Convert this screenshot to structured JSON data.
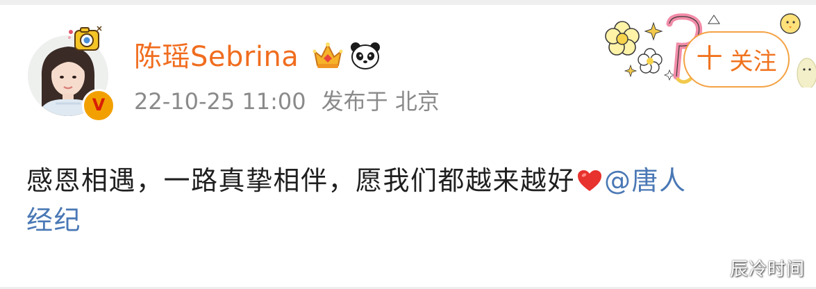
{
  "profile": {
    "username": "陈瑶Sebrina",
    "verified_badge": "V",
    "badge_icons": [
      "crown-icon",
      "panda-icon"
    ],
    "avatar_icon": "profile-photo",
    "accent_color": "#f06d1f"
  },
  "meta": {
    "datetime": "22-10-25 11:00",
    "location": "发布于 北京"
  },
  "follow": {
    "plus": "十",
    "label": "关注",
    "border_color": "#f4a243"
  },
  "post": {
    "text": "感恩相遇，一路真挚相伴，愿我们都越来越好",
    "emoji": "heart-icon",
    "mention_line1": "@唐人",
    "mention_line2": "经纪",
    "mention_color": "#4a78b5"
  },
  "watermark": "辰冷时间"
}
